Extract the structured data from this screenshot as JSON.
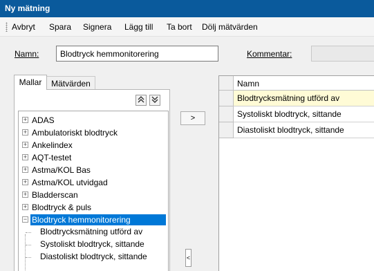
{
  "window": {
    "title": "Ny mätning"
  },
  "toolbar": {
    "items": [
      "Avbryt",
      "Spara",
      "Signera",
      "Lägg till",
      "Ta bort",
      "Dölj mätvärden"
    ]
  },
  "form": {
    "name_label": "Namn:",
    "name_value": "Blodtryck hemmonitorering",
    "comment_label": "Kommentar:",
    "comment_value": ""
  },
  "tabs": {
    "templates": "Mallar",
    "values": "Mätvärden",
    "active": "Mallar"
  },
  "tree": {
    "nodes": [
      "ADAS",
      "Ambulatoriskt blodtryck",
      "Ankelindex",
      "AQT-testet",
      "Astma/KOL Bas",
      "Astma/KOL utvidgad",
      "Bladderscan",
      "Blodtryck & puls",
      "Blodtryck hemmonitorering"
    ],
    "selected": "Blodtryck hemmonitorering",
    "expanded_children": [
      "Blodtrycksmätning utförd av",
      "Systoliskt blodtryck, sittande",
      "Diastoliskt blodtryck, sittande"
    ]
  },
  "buttons": {
    "move_right": ">",
    "move_up": "⌃",
    "move_down": "⌄",
    "collapse": "<"
  },
  "grid": {
    "column_header": "Namn",
    "rows": [
      "Blodtrycksmätning utförd av",
      "Systoliskt blodtryck, sittande",
      "Diastoliskt blodtryck, sittande"
    ]
  },
  "colors": {
    "title_bar": "#0a5a9c",
    "selection": "#0078d7",
    "row_highlight": "#fffbd6"
  }
}
